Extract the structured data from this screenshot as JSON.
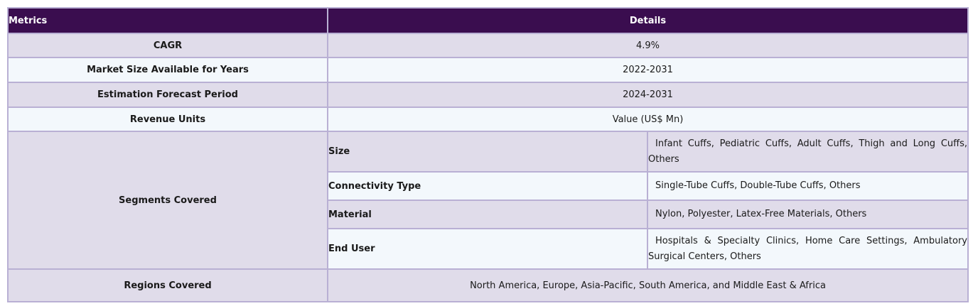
{
  "header": {
    "metrics": "Metrics",
    "details": "Details"
  },
  "rows": [
    {
      "metric": "CAGR",
      "value": "4.9%"
    },
    {
      "metric": "Market Size Available for Years",
      "value": "2022-2031"
    },
    {
      "metric": "Estimation Forecast Period",
      "value": "2024-2031"
    },
    {
      "metric": "Revenue Units",
      "value": "Value (US$ Mn)"
    }
  ],
  "segments": {
    "label": "Segments Covered",
    "items": [
      {
        "label": "Size",
        "value": "Infant Cuffs, Pediatric Cuffs, Adult Cuffs, Thigh and Long Cuffs, Others"
      },
      {
        "label": "Connectivity Type",
        "value": "Single-Tube Cuffs, Double-Tube Cuffs, Others"
      },
      {
        "label": "Material",
        "value": "Nylon, Polyester, Latex-Free Materials, Others"
      },
      {
        "label": "End User",
        "value": "Hospitals & Specialty Clinics, Home Care Settings, Ambulatory Surgical Centers, Others"
      }
    ]
  },
  "regions": {
    "label": "Regions Covered",
    "value": "North America, Europe, Asia-Pacific, South America, and Middle East & Africa"
  }
}
